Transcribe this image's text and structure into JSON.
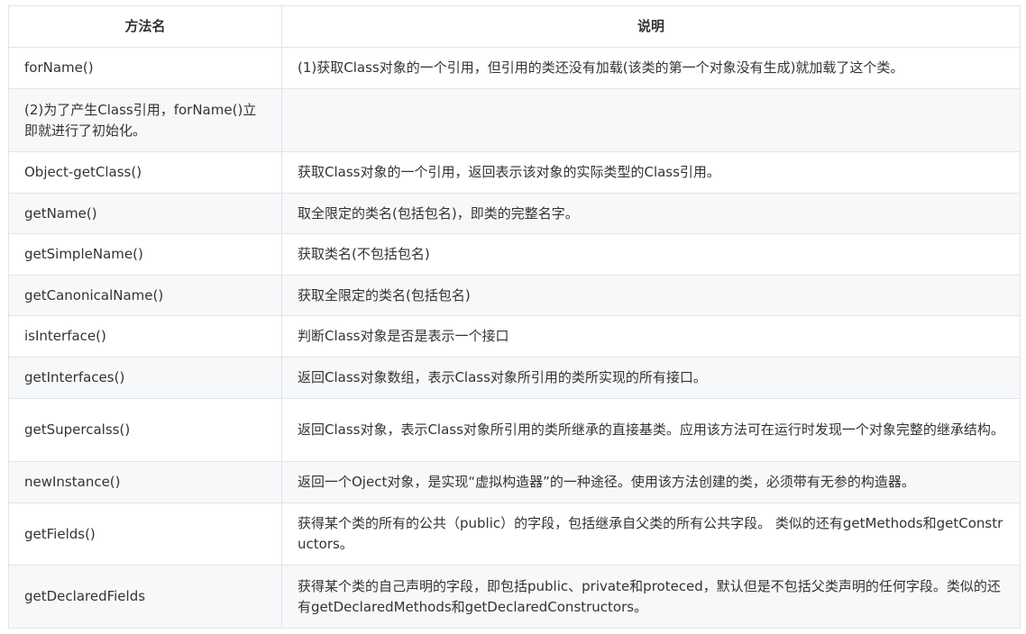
{
  "table": {
    "headers": [
      "方法名",
      "说明"
    ],
    "rows": [
      {
        "name": "forName()",
        "desc": "(1)获取Class对象的一个引用，但引用的类还没有加载(该类的第一个对象没有生成)就加载了这个类。"
      },
      {
        "name": "(2)为了产生Class引用，forName()立即就进行了初始化。",
        "desc": ""
      },
      {
        "name": "Object-getClass()",
        "desc": "获取Class对象的一个引用，返回表示该对象的实际类型的Class引用。"
      },
      {
        "name": "getName()",
        "desc": "取全限定的类名(包括包名)，即类的完整名字。"
      },
      {
        "name": "getSimpleName()",
        "desc": "获取类名(不包括包名)"
      },
      {
        "name": "getCanonicalName()",
        "desc": "获取全限定的类名(包括包名)"
      },
      {
        "name": "isInterface()",
        "desc": "判断Class对象是否是表示一个接口"
      },
      {
        "name": "getInterfaces()",
        "desc": "返回Class对象数组，表示Class对象所引用的类所实现的所有接口。"
      },
      {
        "name": "getSupercalss()",
        "desc": "返回Class对象，表示Class对象所引用的类所继承的直接基类。应用该方法可在运行时发现一个对象完整的继承结构。"
      },
      {
        "name": "newInstance()",
        "desc": "返回一个Oject对象，是实现“虚拟构造器”的一种途径。使用该方法创建的类，必须带有无参的构造器。"
      },
      {
        "name": "getFields()",
        "desc": "获得某个类的所有的公共（public）的字段，包括继承自父类的所有公共字段。 类似的还有getMethods和getConstructors。"
      },
      {
        "name": "getDeclaredFields",
        "desc": "获得某个类的自己声明的字段，即包括public、private和proteced，默认但是不包括父类声明的任何字段。类似的还有getDeclaredMethods和getDeclaredConstructors。"
      }
    ]
  }
}
